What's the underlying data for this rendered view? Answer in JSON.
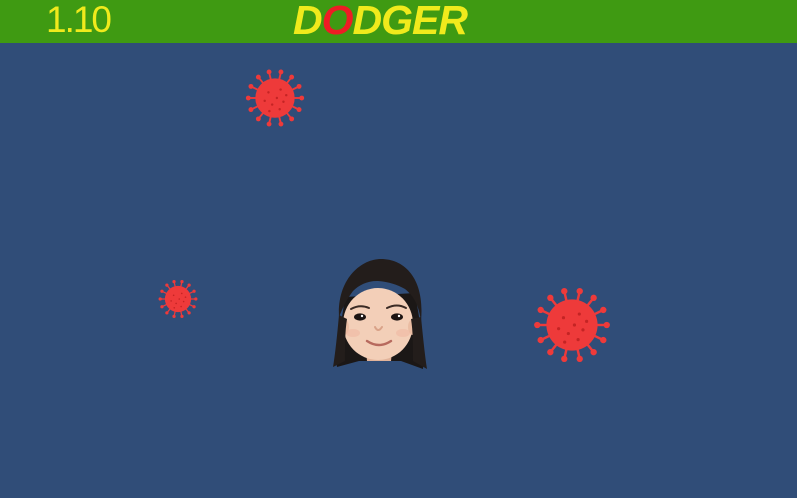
{
  "game": {
    "score": "1.10",
    "title_parts": [
      "D",
      "O",
      "DGER"
    ],
    "colors": {
      "topbar": "#3f9a12",
      "background": "#304d78",
      "title": "#f0ea1c",
      "title_accent": "#ee1c24",
      "virus": "#ee3a3a"
    },
    "sprites": {
      "obstacle_icon": "coronavirus-icon",
      "player_icon": "player-avatar-face"
    }
  }
}
